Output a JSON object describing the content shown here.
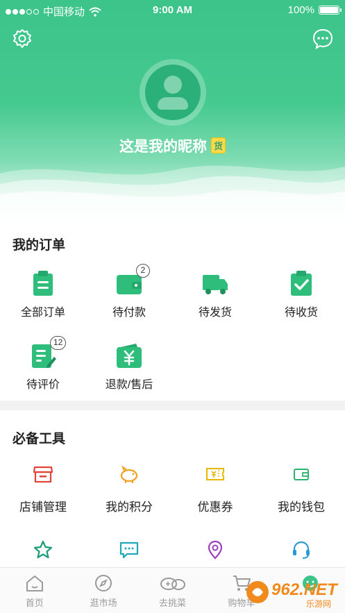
{
  "status_bar": {
    "carrier": "中国移动",
    "time": "9:00 AM",
    "battery": "100%"
  },
  "profile": {
    "nickname": "这是我的昵称",
    "badge": "货"
  },
  "orders": {
    "title": "我的订单",
    "items": [
      {
        "label": "全部订单",
        "icon": "clipboard-icon"
      },
      {
        "label": "待付款",
        "icon": "wallet-icon",
        "count": "2"
      },
      {
        "label": "待发货",
        "icon": "truck-icon"
      },
      {
        "label": "待收货",
        "icon": "checked-clipboard-icon"
      },
      {
        "label": "待评价",
        "icon": "edit-note-icon",
        "count": "12"
      },
      {
        "label": "退款/售后",
        "icon": "yuan-wallet-icon"
      }
    ]
  },
  "tools": {
    "title": "必备工具",
    "items": [
      {
        "label": "店铺管理",
        "icon": "store-icon",
        "color": "#e0453a"
      },
      {
        "label": "我的积分",
        "icon": "piggy-bank-icon",
        "color": "#f0a020"
      },
      {
        "label": "优惠券",
        "icon": "coupon-icon",
        "color": "#e6b800"
      },
      {
        "label": "我的钱包",
        "icon": "wallet-icon",
        "color": "#2eb36e"
      },
      {
        "label": "",
        "icon": "star-icon",
        "color": "#1a9b7a"
      },
      {
        "label": "",
        "icon": "chat-icon",
        "color": "#1fa9b8"
      },
      {
        "label": "",
        "icon": "location-icon",
        "color": "#9b3dbf"
      },
      {
        "label": "",
        "icon": "headset-icon",
        "color": "#2a9ad6"
      }
    ]
  },
  "tab_bar": {
    "items": [
      {
        "label": "首页",
        "icon": "home-icon"
      },
      {
        "label": "逛市场",
        "icon": "compass-icon"
      },
      {
        "label": "去挑菜",
        "icon": "vegetable-icon"
      },
      {
        "label": "购物车",
        "icon": "cart-icon"
      },
      {
        "label": "",
        "icon": "profile-smile-icon"
      }
    ]
  },
  "watermark": {
    "text": "962.NET",
    "sub": "乐游网"
  },
  "colors": {
    "primary_green": "#3cc48a",
    "icon_green": "#2ebd7a"
  }
}
